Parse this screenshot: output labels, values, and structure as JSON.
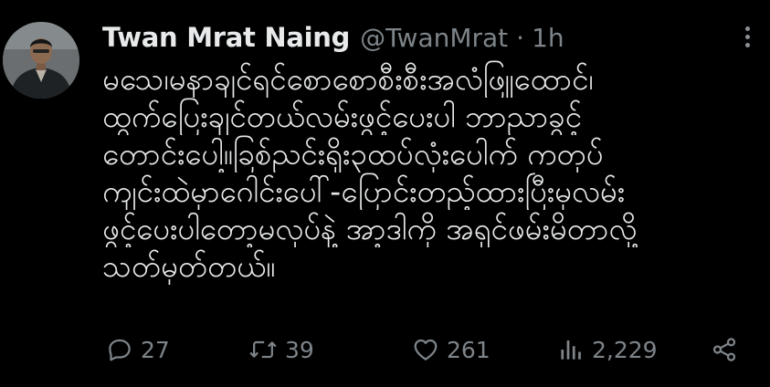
{
  "tweet": {
    "author_name": "Twan Mrat Naing",
    "handle": "@TwanMrat",
    "separator": "·",
    "time": "1h",
    "body_lines": [
      "မသေ၊မနာချင်ရင်စောစောစီးစီးအလံဖြူထောင်၊",
      "ထွက်ပြေးချင်တယ်လမ်းဖွင့်ပေးပါ ဘာညာခွင့်",
      "တောင်းပေါ့။ခြစ်ညင်းရိုး၃ထပ်လုံးပေါက် ကတုပ်",
      "ကျင်းထဲမှာဂေါင်းပေါ်-ပြောင်းတည့်ထားပြီးမှလမ်း",
      "ဖွင့်ပေးပါတော့မလုပ်နဲ့ အာ့ဒါကို အရှင်ဖမ်းမိတာလို့",
      "သတ်မှတ်တယ်။"
    ],
    "actions": {
      "replies": "27",
      "retweets": "39",
      "likes": "261",
      "views": "2,229"
    },
    "icons": {
      "avatar": "profile-photo",
      "more": "more-options-icon",
      "reply": "reply-icon",
      "retweet": "retweet-icon",
      "like": "heart-icon",
      "views": "analytics-bars-icon",
      "share": "share-icon"
    },
    "colors": {
      "background": "#000000",
      "primary_text": "#e7e9ea",
      "secondary_text": "#7d8489"
    }
  }
}
